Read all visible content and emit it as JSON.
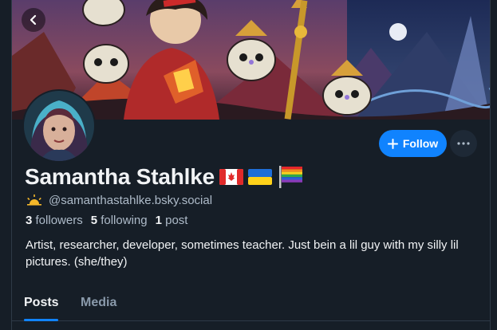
{
  "header": {
    "back_icon": "chevron-left-icon"
  },
  "profile": {
    "display_name": "Samantha Stahlke",
    "flags": [
      "canada-flag-icon",
      "ukraine-flag-icon",
      "pride-flag-icon"
    ],
    "status_icon": "sunrise-icon",
    "handle": "@samanthastahlke.bsky.social",
    "followers_count": "3",
    "followers_label": "followers",
    "following_count": "5",
    "following_label": "following",
    "posts_count": "1",
    "posts_label": "post",
    "bio": "Artist, researcher, developer, sometimes teacher. Just bein a lil guy with my silly lil pictures. (she/they)"
  },
  "actions": {
    "follow_label": "Follow",
    "follow_icon": "plus-icon",
    "more_icon": "ellipsis-icon"
  },
  "tabs": [
    {
      "label": "Posts",
      "active": true
    },
    {
      "label": "Media",
      "active": false
    }
  ],
  "colors": {
    "background": "#161e27",
    "accent": "#1083fe",
    "text_primary": "#f1f3f5",
    "text_secondary": "#aebbc9"
  }
}
